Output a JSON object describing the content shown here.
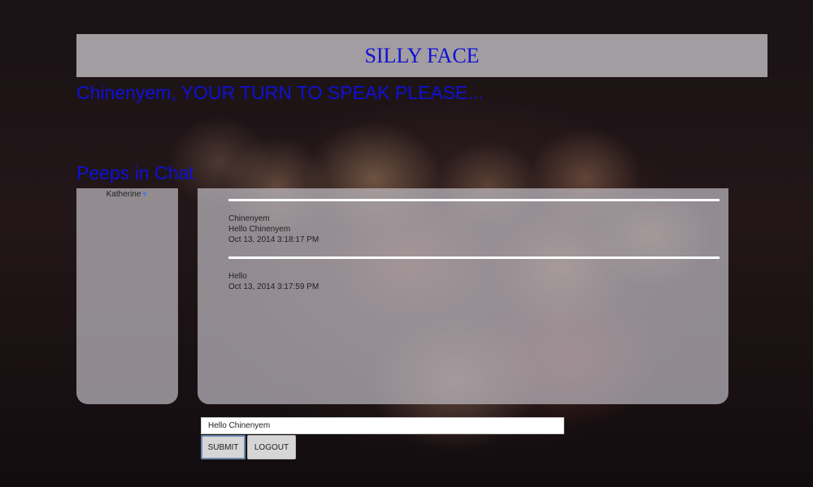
{
  "header": {
    "title": "SILLY FACE"
  },
  "turn_message": "Chinenyem, YOUR TURN TO SPEAK PLEASE...",
  "users_panel": {
    "heading": "Peeps in Chat",
    "users": [
      {
        "name": "Katherine",
        "icon": "filter-icon"
      }
    ]
  },
  "chat": {
    "messages": [
      {
        "sender": "Chinenyem",
        "text": "Hello Chinenyem",
        "timestamp": "Oct 13, 2014 3:18:17 PM"
      },
      {
        "text": "Hello",
        "timestamp": "Oct 13, 2014 3:17:59 PM"
      }
    ]
  },
  "input": {
    "value": "Hello Chinenyem"
  },
  "buttons": {
    "submit_label": "SUBMIT",
    "logout_label": "LOGOUT"
  },
  "colors": {
    "accent_text": "#1010d8",
    "panel": "#bebac0"
  }
}
